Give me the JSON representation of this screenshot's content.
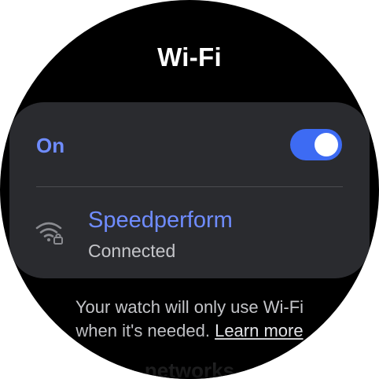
{
  "header": {
    "title": "Wi-Fi"
  },
  "wifi_toggle": {
    "label": "On",
    "state": "on",
    "accent_color": "#3d6bf3"
  },
  "network": {
    "name": "Speedperform",
    "status": "Connected",
    "icon": "wifi-lock-icon"
  },
  "info": {
    "text_line1": "Your watch will only use Wi-Fi",
    "text_line2": "when it's needed.",
    "learn_more": "Learn more"
  },
  "next_section": {
    "label": "networks"
  }
}
